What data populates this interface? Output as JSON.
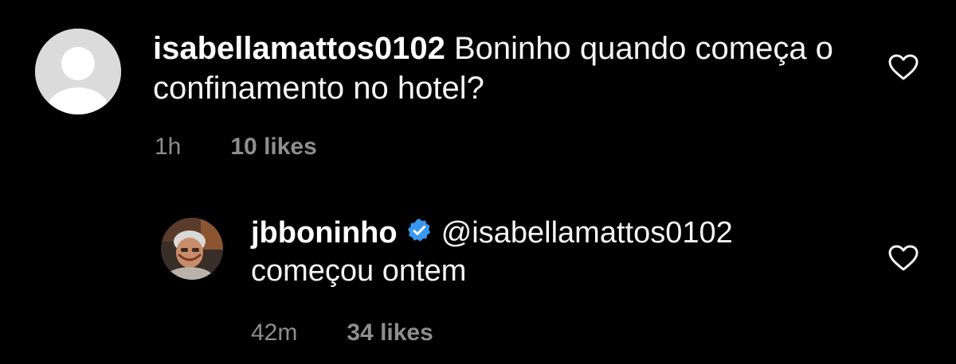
{
  "comments": [
    {
      "username": "isabellamattos0102",
      "text_line1": "Boninho quando começa o",
      "text_line2": "confinamento no hotel?",
      "time": "1h",
      "likes": "10 likes",
      "avatar": "default-avatar-icon"
    },
    {
      "username": "jbboninho",
      "mention": "@isabellamattos0102",
      "text_line2": "começou ontem",
      "time": "42m",
      "likes": "34 likes",
      "verified": true,
      "avatar": "profile-photo"
    }
  ],
  "icons": {
    "like": "heart-icon",
    "verified": "verified-badge-icon"
  },
  "colors": {
    "background": "#000000",
    "text": "#f5f5f5",
    "meta": "#8e8e8e",
    "verified": "#3897f0"
  }
}
